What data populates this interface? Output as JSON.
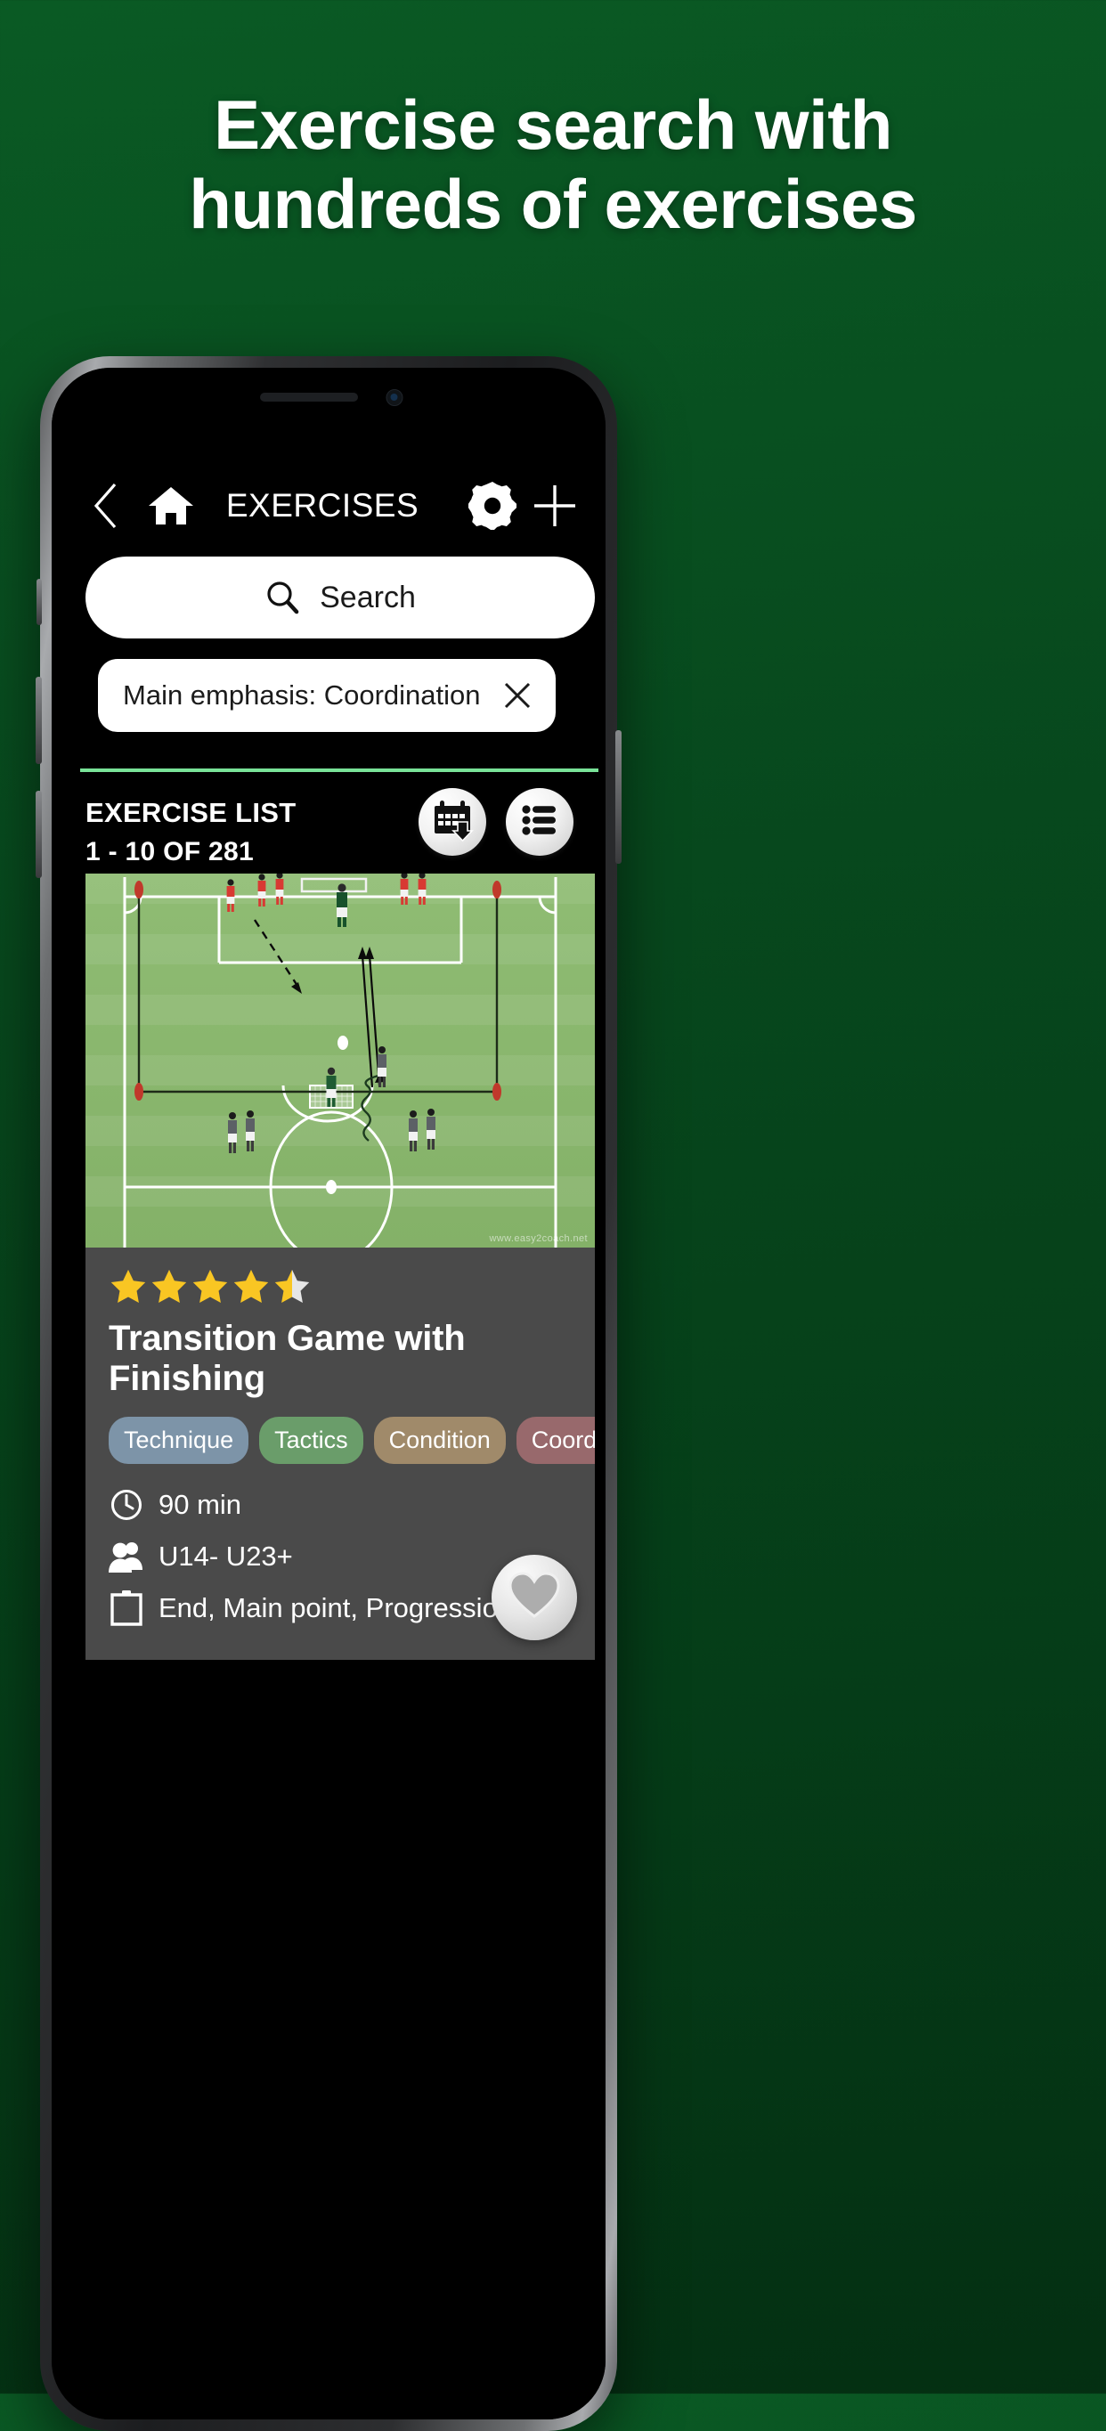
{
  "promo": {
    "headline_line1": "Exercise search with",
    "headline_line2": "hundreds of exercises",
    "background_color": "#07481d"
  },
  "app": {
    "header": {
      "back_icon": "chevron-left-icon",
      "home_icon": "home-icon",
      "title": "EXERCISES",
      "settings_icon": "gear-icon",
      "add_icon": "plus-icon"
    },
    "search": {
      "icon": "search-icon",
      "placeholder": "Search",
      "value": ""
    },
    "filters": [
      {
        "label": "Main emphasis: Coordination",
        "remove_icon": "close-icon"
      }
    ],
    "list_header": {
      "title": "EXERCISE LIST",
      "count": "1 - 10 OF 281",
      "calendar_button_icon": "calendar-download-icon",
      "list_button_icon": "list-icon",
      "accent_color": "#79e398"
    },
    "exercise": {
      "rating": 4.5,
      "rating_max": 5,
      "star_color": "#f9c623",
      "star_empty_color": "#e6e6e6",
      "title": "Transition Game with Finishing",
      "tags": [
        {
          "label": "Technique",
          "color": "#7d94a8"
        },
        {
          "label": "Tactics",
          "color": "#6a9d6a"
        },
        {
          "label": "Condition",
          "color": "#a08a6a"
        },
        {
          "label": "Coordination",
          "color": "#98696c"
        }
      ],
      "meta": [
        {
          "icon": "clock-icon",
          "text": "90 min"
        },
        {
          "icon": "people-icon",
          "text": "U14- U23+"
        },
        {
          "icon": "clipboard-icon",
          "text": "End, Main point, Progression"
        }
      ],
      "favorite_icon": "heart-icon",
      "favorite_active": false,
      "diagram": {
        "type": "soccer-pitch-diagram",
        "watermark": "www.easy2coach.net",
        "pitch_color": "#8cb96f",
        "line_color": "#ffffff",
        "teams": [
          {
            "name": "red-team",
            "color": "#d83a33",
            "count": 6
          },
          {
            "name": "grey-team",
            "color": "#5c6066",
            "count": 5
          },
          {
            "name": "goalkeepers",
            "color": "#17512b",
            "count": 2
          }
        ],
        "cones": 4,
        "balls": 2,
        "movement_arrows": 4
      }
    }
  }
}
